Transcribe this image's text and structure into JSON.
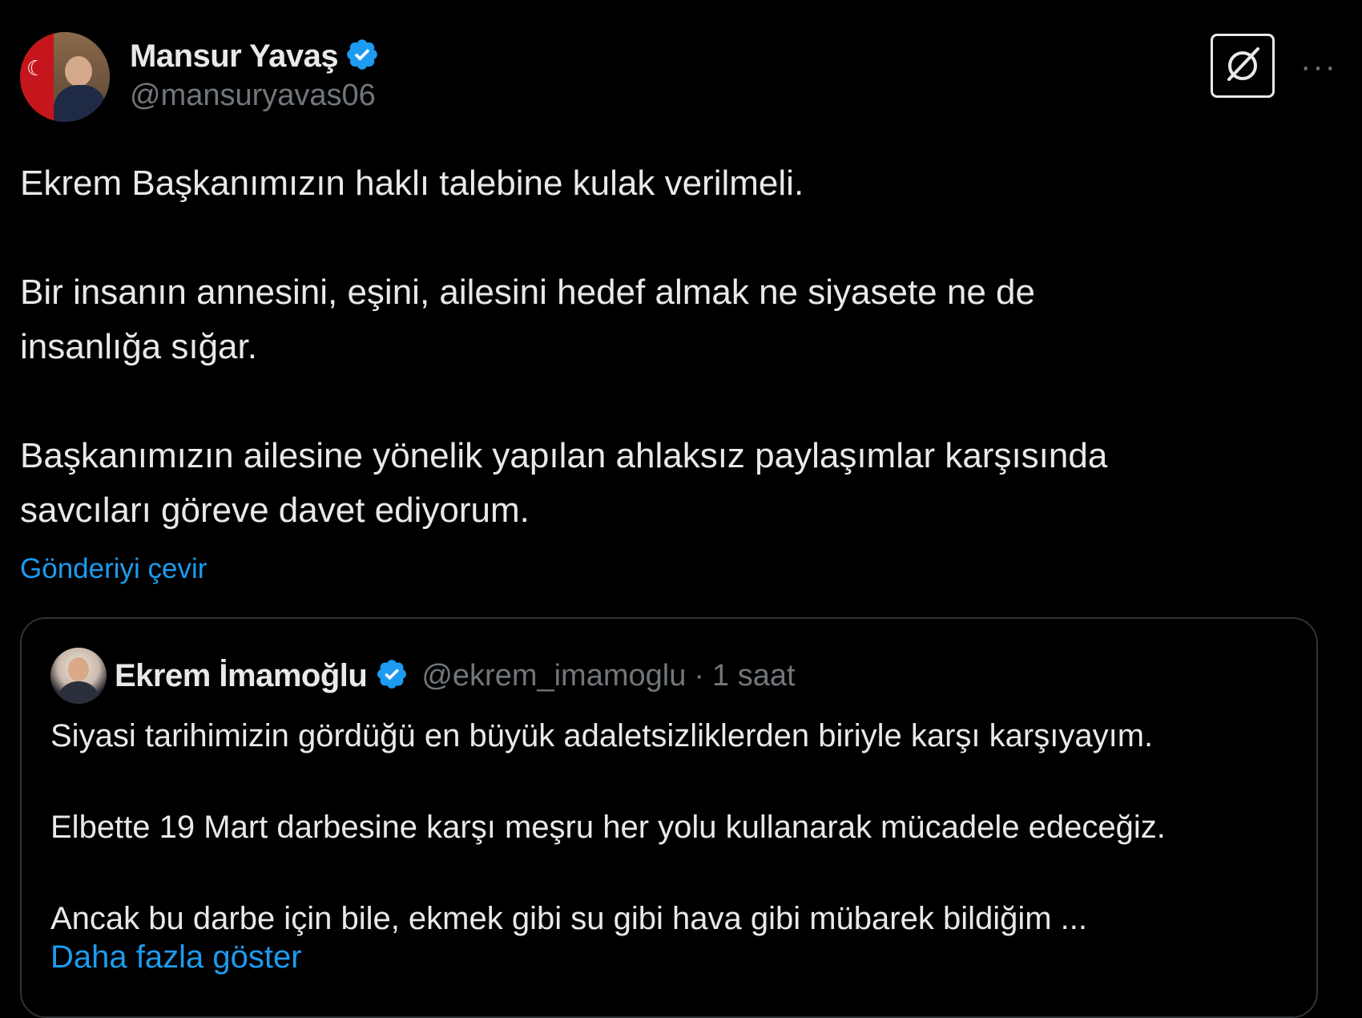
{
  "colors": {
    "background": "#000000",
    "text": "#e7e9ea",
    "secondary_text": "#71767b",
    "link": "#1d9bf0",
    "verified_badge": "#1d9bf0",
    "border": "#2f3336"
  },
  "post": {
    "author": {
      "name": "Mansur Yavaş",
      "handle": "@mansuryavas06",
      "avatar_icon": "profile-photo",
      "verified_icon": "verified-badge-icon"
    },
    "actions": {
      "grok_icon": "grok-icon",
      "more_icon": "more-options-icon",
      "more_label": "···"
    },
    "text": {
      "line1": "Ekrem Başkanımızın haklı talebine kulak verilmeli.",
      "line2": "Bir insanın annesini, eşini, ailesini hedef almak ne siyasete ne de",
      "line3": "insanlığa sığar.",
      "line4": "Başkanımızın ailesine yönelik yapılan ahlaksız paylaşımlar karşısında",
      "line5": "savcıları göreve davet ediyorum."
    },
    "translate_label": "Gönderiyi çevir"
  },
  "quote": {
    "author": {
      "name": "Ekrem İmamoğlu",
      "handle": "@ekrem_imamoglu",
      "separator": "·",
      "time": "1 saat",
      "verified_icon": "verified-badge-icon"
    },
    "text": {
      "line1": "Siyasi tarihimizin gördüğü en büyük adaletsizliklerden biriyle karşı karşıyayım.",
      "line2": "Elbette 19 Mart darbesine karşı meşru her yolu kullanarak mücadele edeceğiz.",
      "line3": "Ancak bu darbe için bile, ekmek gibi su gibi hava gibi mübarek bildiğim ..."
    },
    "show_more_label": "Daha fazla göster"
  }
}
